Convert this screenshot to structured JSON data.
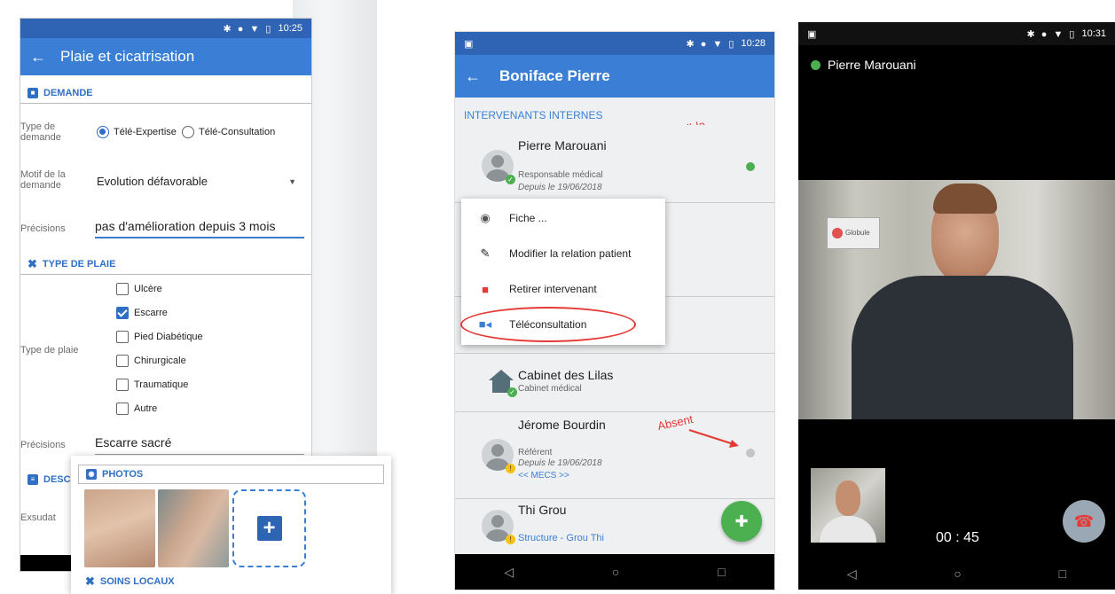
{
  "phone1": {
    "status_time": "10:25",
    "title": "Plaie et cicatrisation",
    "section_demande": "DEMANDE",
    "type_demande_label": "Type de demande",
    "radio_1": "Télé-Expertise",
    "radio_2": "Télé-Consultation",
    "motif_label": "Motif de la demande",
    "motif_value": "Evolution défavorable",
    "precisions_label": "Précisions",
    "precisions_value": "pas d'amélioration depuis 3 mois",
    "section_type_plaie": "TYPE DE PLAIE",
    "type_plaie_label": "Type de plaie",
    "checkboxes": [
      {
        "label": "Ulcère",
        "checked": false
      },
      {
        "label": "Escarre",
        "checked": true
      },
      {
        "label": "Pied Diabétique",
        "checked": false
      },
      {
        "label": "Chirurgicale",
        "checked": false
      },
      {
        "label": "Traumatique",
        "checked": false
      },
      {
        "label": "Autre",
        "checked": false
      }
    ],
    "precisions2_label": "Précisions",
    "precisions2_value": "Escarre sacré",
    "section_desc": "DESCR",
    "exsudat_label": "Exsudat",
    "photos_title": "PHOTOS",
    "soins_locaux": "SOINS LOCAUX"
  },
  "phone2": {
    "status_time": "10:28",
    "title": "Boniface Pierre",
    "section": "INTERVENANTS INTERNES",
    "annotation_available": "Disponible",
    "annotation_absent": "Absent",
    "p1_name": "Pierre Marouani",
    "p1_role": "Responsable médical",
    "p1_since": "Depuis le 19/06/2018",
    "menu": [
      "Fiche ...",
      "Modifier la relation patient",
      "Retirer intervenant",
      "Téléconsultation"
    ],
    "cab_name": "Cabinet des Lilas",
    "cab_sub": "Cabinet médical",
    "p2_name": "Jérome Bourdin",
    "p2_role": "Référent",
    "p2_since": "Depuis le 19/06/2018",
    "p2_link": "<< MECS >>",
    "p3_name": "Thi Grou",
    "p3_sub": "Structure - Grou Thi"
  },
  "phone3": {
    "status_time": "10:31",
    "caller": "Pierre Marouani",
    "sign_text": "Globule",
    "timer": "00 : 45"
  },
  "colors": {
    "primary": "#3a7fd5",
    "green": "#4caf50",
    "red": "#e53935"
  }
}
